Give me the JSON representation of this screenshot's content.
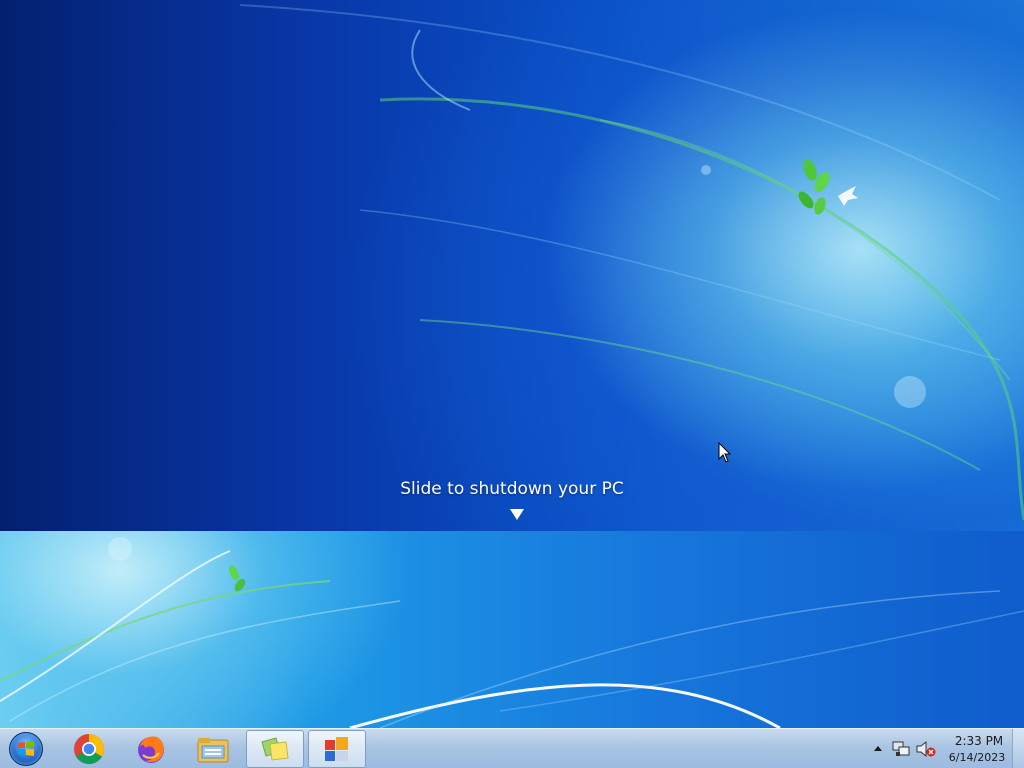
{
  "shutdown": {
    "label": "Slide to shutdown your PC"
  },
  "taskbar": {
    "start_icon": "windows-logo-icon",
    "pinned": [
      {
        "name": "chrome-icon",
        "app": "Google Chrome"
      },
      {
        "name": "firefox-icon",
        "app": "Firefox"
      },
      {
        "name": "file-explorer-icon",
        "app": "Windows Explorer"
      },
      {
        "name": "sticky-notes-icon",
        "app": "Sticky Notes"
      },
      {
        "name": "slide-to-shutdown-icon",
        "app": "SlideToShutDown"
      }
    ],
    "tray": {
      "network_icon": "network-icon",
      "volume_icon": "volume-muted-icon"
    },
    "clock": {
      "time": "2:33 PM",
      "date": "6/14/2023"
    }
  },
  "colors": {
    "wallpaper_dark": "#03206f",
    "wallpaper_light": "#6fd0f0",
    "taskbar": "#a9c4e2",
    "leaf_green": "#5fcf3a"
  }
}
